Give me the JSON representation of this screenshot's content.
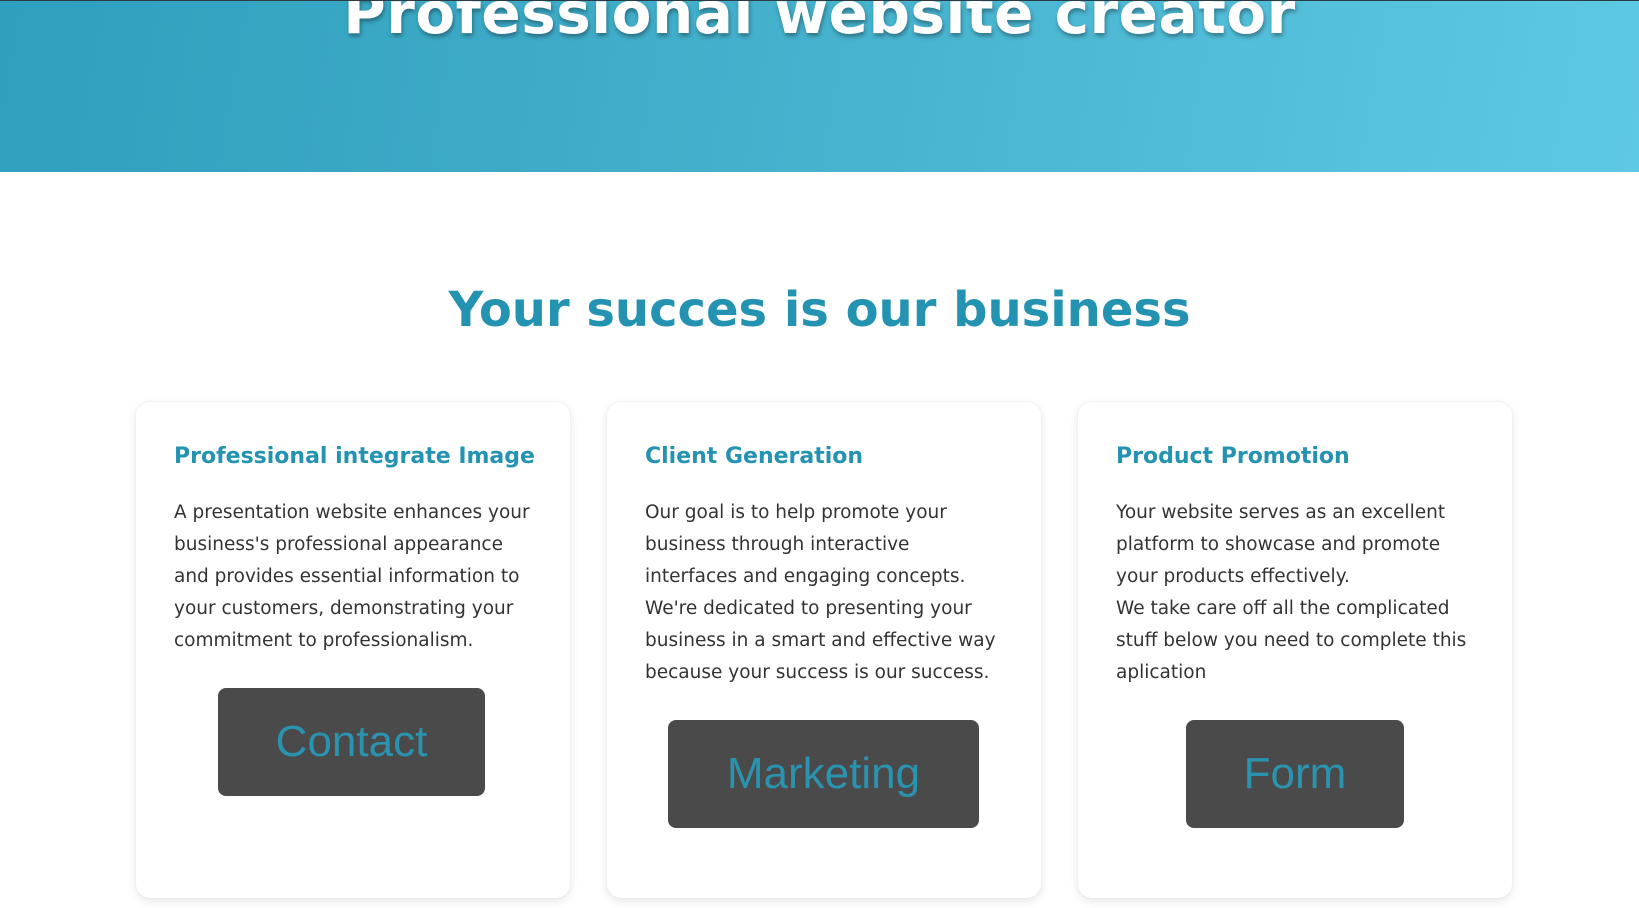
{
  "hero": {
    "title": "Professional website creator"
  },
  "section": {
    "title": "Your succes is our business"
  },
  "cards": [
    {
      "title": "Professional integrate Image",
      "lines": [
        "A presentation website enhances your",
        "business's professional appearance",
        "and provides essential information to",
        "your customers, demonstrating your",
        "commitment to professionalism."
      ],
      "button_label": "Contact"
    },
    {
      "title": "Client Generation",
      "lines": [
        "Our goal is to help promote your",
        "business through interactive",
        "interfaces and engaging concepts.",
        "We're dedicated to presenting your",
        "business in a smart and effective way",
        "because your success is our success."
      ],
      "button_label": "Marketing"
    },
    {
      "title": "Product Promotion",
      "lines": [
        "Your website serves as an excellent",
        "platform to showcase and promote",
        "your products effectively.",
        "We take care off all the complicated",
        "stuff below you need to complete this",
        "aplication"
      ],
      "button_label": "Form"
    }
  ],
  "colors": {
    "accent": "#2493b1",
    "button_bg": "#4a4a4a",
    "hero_gradient_start": "#2e9fbd",
    "hero_gradient_end": "#5ec9e4"
  }
}
